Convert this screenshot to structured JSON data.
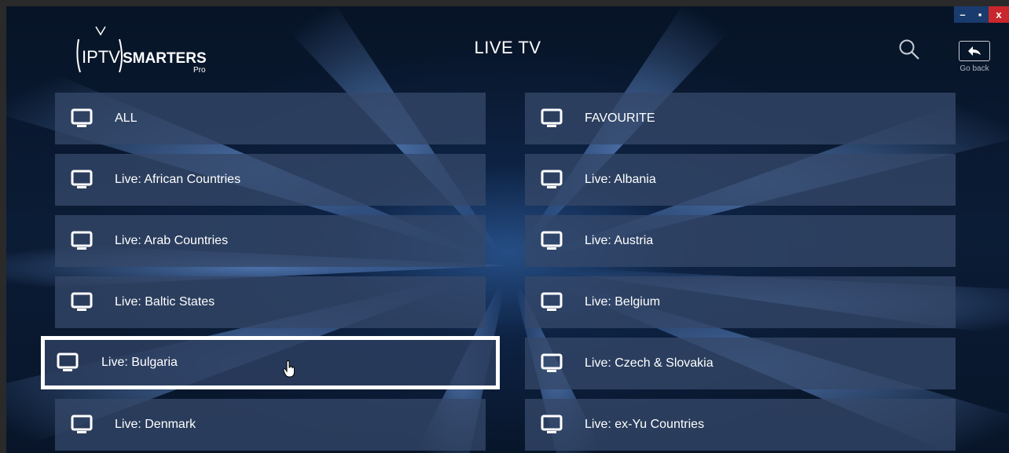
{
  "window_controls": {
    "minimize": "–",
    "restore": "▪",
    "close": "x"
  },
  "app": {
    "brand_left": "IPTV",
    "brand_right": "SMARTERS",
    "brand_sub": "Pro"
  },
  "header": {
    "title": "LIVE TV",
    "go_back_label": "Go back"
  },
  "categories": {
    "left": [
      {
        "label": "ALL"
      },
      {
        "label": "Live: African Countries"
      },
      {
        "label": "Live: Arab Countries"
      },
      {
        "label": "Live: Baltic States"
      },
      {
        "label": "Live: Bulgaria",
        "selected": true
      },
      {
        "label": "Live: Denmark"
      }
    ],
    "right": [
      {
        "label": "FAVOURITE"
      },
      {
        "label": "Live: Albania"
      },
      {
        "label": "Live: Austria"
      },
      {
        "label": "Live: Belgium"
      },
      {
        "label": "Live: Czech & Slovakia"
      },
      {
        "label": "Live: ex-Yu Countries"
      }
    ]
  },
  "colors": {
    "accent_close": "#c9272d",
    "tile": "#344869",
    "selection_border": "#ffffff"
  }
}
